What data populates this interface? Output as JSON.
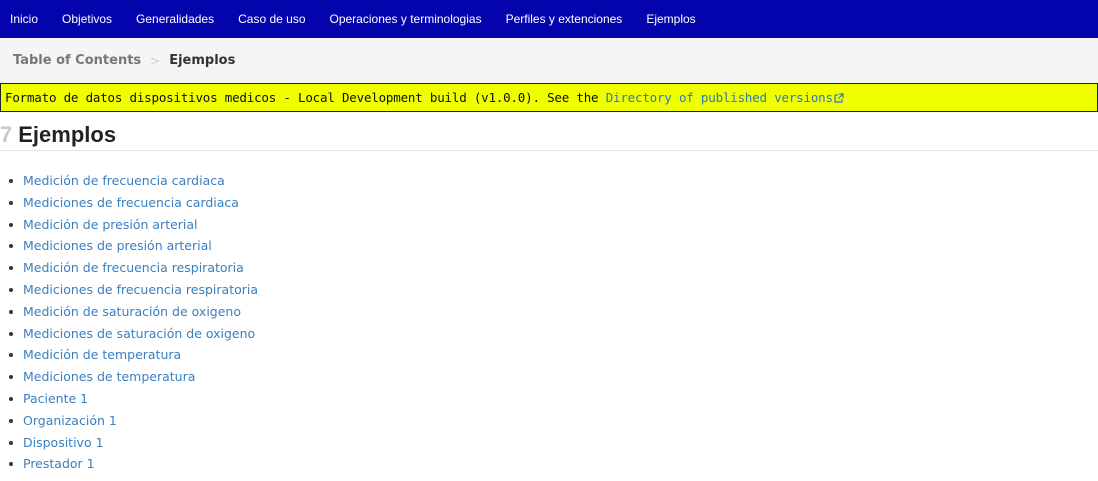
{
  "nav": {
    "items": [
      "Inicio",
      "Objetivos",
      "Generalidades",
      "Caso de uso",
      "Operaciones y terminologias",
      "Perfiles y extenciones",
      "Ejemplos"
    ]
  },
  "breadcrumb": {
    "root": "Table of Contents",
    "separator": ">",
    "current": "Ejemplos"
  },
  "banner": {
    "text": "Formato de datos dispositivos medicos - Local Development build (v1.0.0). See the ",
    "link": "Directory of published versions"
  },
  "page": {
    "section_number": "7",
    "title": "Ejemplos"
  },
  "examples": [
    "Medición de frecuencia cardiaca",
    "Mediciones de frecuencia cardiaca",
    "Medición de presión arterial",
    "Mediciones de presión arterial",
    "Medición de frecuencia respiratoria",
    "Mediciones de frecuencia respiratoria",
    "Medición de saturación de oxigeno",
    "Mediciones de saturación de oxigeno",
    "Medición de temperatura",
    "Mediciones de temperatura",
    "Paciente 1",
    "Organización 1",
    "Dispositivo 1",
    "Prestador 1"
  ],
  "colors": {
    "nav_bg": "#0404ad",
    "banner_bg": "#f0ff00",
    "link": "#3a7fbf"
  }
}
